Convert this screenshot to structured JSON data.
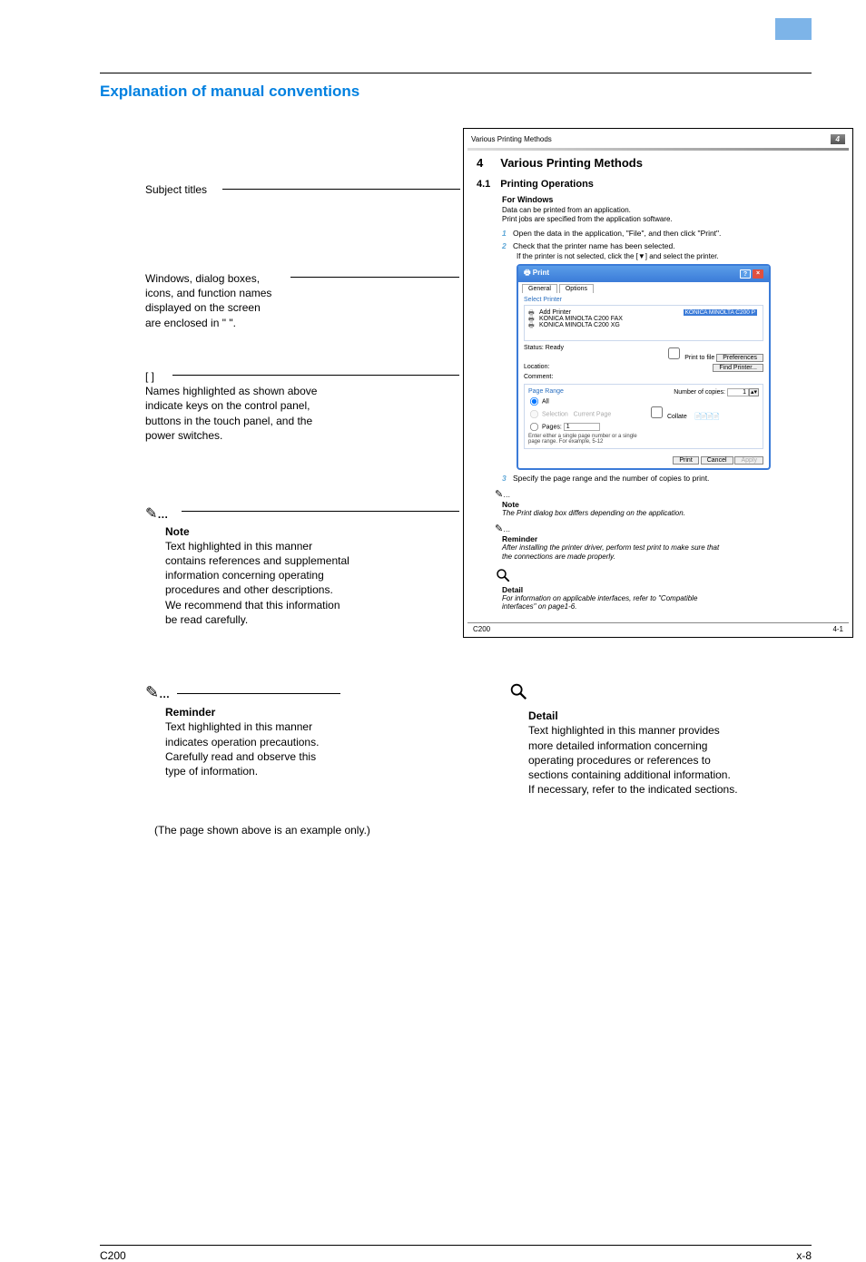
{
  "section_title": "Explanation of manual conventions",
  "anno": {
    "subject": {
      "label": "Subject titles"
    },
    "windows": {
      "l1": "Windows, dialog boxes,",
      "l2": "icons, and function names",
      "l3": "displayed on the screen",
      "l4": "are enclosed in \"  \"."
    },
    "brackets": {
      "l0": "[  ]",
      "l1": "Names highlighted as shown above",
      "l2": "indicate keys on the control panel,",
      "l3": "buttons in the touch panel, and the",
      "l4": "power switches."
    },
    "note": {
      "dots": "…",
      "head": "Note",
      "l1": "Text highlighted in this manner",
      "l2": "contains references and supplemental",
      "l3": "information concerning operating",
      "l4": "procedures and other descriptions.",
      "l5": "We recommend that this information",
      "l6": "be read carefully."
    },
    "reminder": {
      "dots": "…",
      "head": "Reminder",
      "l1": "Text highlighted in this manner",
      "l2": "indicates operation precautions.",
      "l3": "Carefully read and observe this",
      "l4": "type of information."
    },
    "detail": {
      "head": "Detail",
      "l1": "Text highlighted in this manner provides",
      "l2": "more detailed information concerning",
      "l3": "operating procedures or references to",
      "l4": "sections containing additional information.",
      "l5": "If necessary, refer to the indicated sections."
    }
  },
  "sample": {
    "header_title": "Various Printing Methods",
    "header_num": "4",
    "sec_num": "4",
    "sec_title": "Various Printing Methods",
    "sub_num": "4.1",
    "sub_title": "Printing Operations",
    "h4": "For Windows",
    "body_l1": "Data can be printed from an application.",
    "body_l2": "Print jobs are specified from the application software.",
    "step1_n": "1",
    "step1": "Open the data in the application, \"File\", and then click \"Print\".",
    "step2_n": "2",
    "step2": "Check that the printer name has been selected.",
    "step2_sub": "If the printer is not selected, click the [▼] and select the printer.",
    "step3_n": "3",
    "step3": "Specify the page range and the number of copies to print.",
    "note_dots": "…",
    "note_head": "Note",
    "note_body": "The Print dialog box differs depending on the application.",
    "rem_dots": "…",
    "rem_head": "Reminder",
    "rem_body1": "After installing the printer driver, perform test print to make sure that",
    "rem_body2": "the connections are made properly.",
    "det_head": "Detail",
    "det_body1": "For information on applicable interfaces, refer to \"Compatible",
    "det_body2": "interfaces\" on page1-6.",
    "footer_left": "C200",
    "footer_right": "4-1"
  },
  "print_dialog": {
    "title": "Print",
    "tab1": "General",
    "tab2": "Options",
    "select_printer": "Select Printer",
    "add_printer": "Add Printer",
    "sel": "KONICA MINOLTA C200 P",
    "p1": "KONICA MINOLTA C200 FAX",
    "p2": "KONICA MINOLTA C200 XG",
    "status_label": "Status:",
    "status_val": "Ready",
    "location": "Location:",
    "comment": "Comment:",
    "print_to_file": "Print to file",
    "preferences": "Preferences",
    "find_printer": "Find Printer...",
    "page_range": "Page Range",
    "all": "All",
    "selection": "Selection",
    "current_page": "Current Page",
    "pages": "Pages:",
    "pages_val": "1",
    "pages_hint": "Enter either a single page number or a single page range. For example, 5-12",
    "copies_label": "Number of copies:",
    "copies_val": "1",
    "collate": "Collate",
    "print_btn": "Print",
    "cancel_btn": "Cancel",
    "apply_btn": "Apply"
  },
  "example_note": "(The page shown above is an example only.)",
  "footer": {
    "left": "C200",
    "right": "x-8"
  }
}
